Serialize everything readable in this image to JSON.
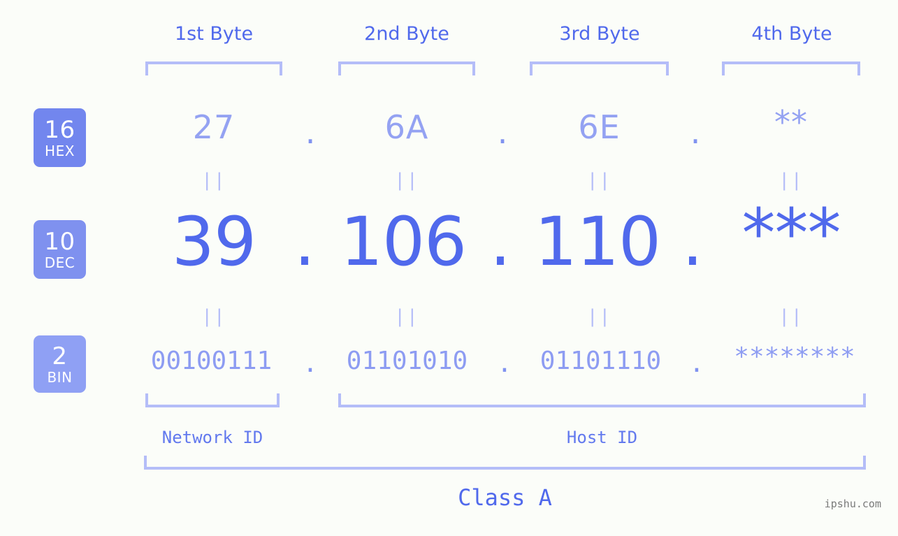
{
  "page": {
    "background_color": "#fbfdf9",
    "accent_color": "#5069ec",
    "accent_light_color": "#b4bdf8",
    "badge_color": "#7286ee",
    "watermark": "ipshu.com"
  },
  "byte_headers": [
    {
      "label": "1st Byte"
    },
    {
      "label": "2nd Byte"
    },
    {
      "label": "3rd Byte"
    },
    {
      "label": "4th Byte"
    }
  ],
  "radix_badges": [
    {
      "number": "16",
      "system": "HEX"
    },
    {
      "number": "10",
      "system": "DEC"
    },
    {
      "number": "2",
      "system": "BIN"
    }
  ],
  "rows": {
    "hex": {
      "values": [
        "27",
        "6A",
        "6E",
        "**"
      ],
      "separator": "."
    },
    "dec": {
      "values": [
        "39",
        "106",
        "110",
        "***"
      ],
      "separator": "."
    },
    "bin": {
      "values": [
        "00100111",
        "01101010",
        "01101110",
        "********"
      ],
      "separator": "."
    }
  },
  "equality_marks": {
    "symbol": "||",
    "count_per_row": 4
  },
  "id_sections": [
    {
      "label": "Network ID"
    },
    {
      "label": "Host ID"
    }
  ],
  "class_section": {
    "label": "Class A"
  }
}
